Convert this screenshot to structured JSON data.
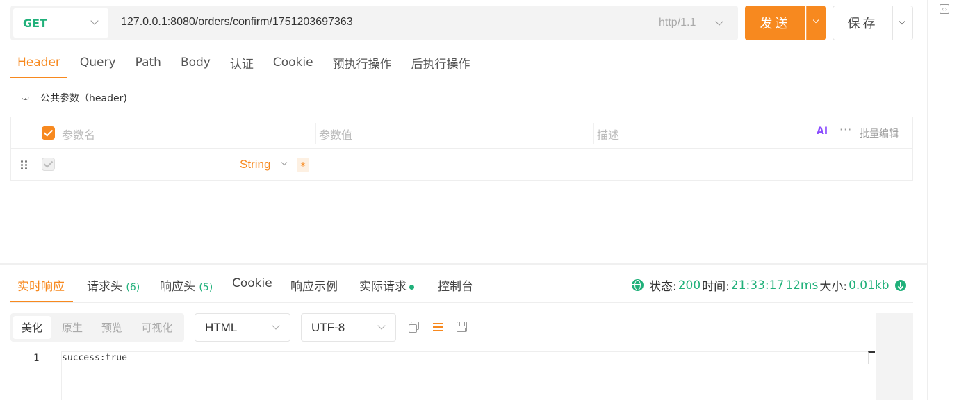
{
  "request": {
    "method": "GET",
    "url": "127.0.0.1:8080/orders/confirm/1751203697363",
    "protocol": "http/1.1",
    "send_label": "发送",
    "save_label": "保存"
  },
  "request_tabs": [
    {
      "label": "Header",
      "active": true
    },
    {
      "label": "Query"
    },
    {
      "label": "Path"
    },
    {
      "label": "Body"
    },
    {
      "label": "认证"
    },
    {
      "label": "Cookie"
    },
    {
      "label": "预执行操作"
    },
    {
      "label": "后执行操作"
    }
  ],
  "common_params_label": "公共参数（header)",
  "params_table": {
    "headers": {
      "name": "参数名",
      "value": "参数值",
      "description": "描述"
    },
    "ai_label": "AI",
    "more_label": "···",
    "bulk_edit_label": "批量编辑",
    "row": {
      "type": "String",
      "required_mark": "*"
    }
  },
  "response_tabs": {
    "realtime": "实时响应",
    "request_headers": "请求头",
    "request_headers_count": "(6)",
    "response_headers": "响应头",
    "response_headers_count": "(5)",
    "cookie": "Cookie",
    "examples": "响应示例",
    "actual_request": "实际请求",
    "console": "控制台"
  },
  "status": {
    "status_label": "状态:",
    "status_value": "200",
    "time_label": "时间:",
    "time_value": "21:33:17",
    "duration": "12ms",
    "size_label": "大小:",
    "size_value": "0.01kb"
  },
  "view_modes": [
    "美化",
    "原生",
    "预览",
    "可视化"
  ],
  "format_select": "HTML",
  "encoding_select": "UTF-8",
  "editor": {
    "lines": [
      {
        "num": "1",
        "text": "success:true"
      }
    ]
  },
  "colors": {
    "accent": "#f7891f",
    "success": "#20b07a"
  }
}
